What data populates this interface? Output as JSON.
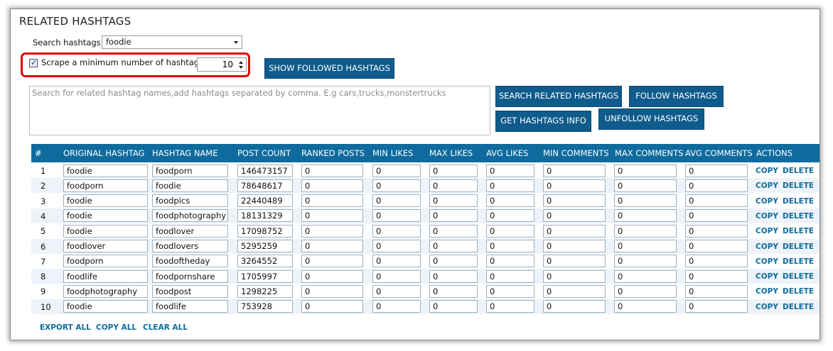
{
  "title": "RELATED HASHTAGS",
  "search": {
    "label": "Search hashtags",
    "value": "foodie"
  },
  "scrape": {
    "label": "Scrape a minimum number of hashtags",
    "checked": "✓",
    "value": "10"
  },
  "buttons": {
    "show_followed": "SHOW FOLLOWED HASHTAGS",
    "search_related": "SEARCH RELATED HASHTAGS",
    "follow": "FOLLOW HASHTAGS",
    "get_info": "GET HASHTAGS INFO",
    "unfollow": "UNFOLLOW HASHTAGS"
  },
  "textarea_placeholder": "Search for related hashtag names,add hashtags separated by comma. E.g cars,trucks,monstertrucks",
  "table": {
    "headers": [
      "#",
      "ORIGINAL HASHTAG",
      "HASHTAG NAME",
      "POST COUNT",
      "RANKED POSTS",
      "MIN LIKES",
      "MAX LIKES",
      "AVG LIKES",
      "MIN COMMENTS",
      "MAX COMMENTS",
      "AVG COMMENTS",
      "ACTIONS"
    ],
    "rows": [
      {
        "num": "1",
        "original": "foodie",
        "name": "foodporn",
        "post_count": "146473157",
        "ranked": "0",
        "min_likes": "0",
        "max_likes": "0",
        "avg_likes": "0",
        "min_comments": "0",
        "max_comments": "0",
        "avg_comments": "0"
      },
      {
        "num": "2",
        "original": "foodporn",
        "name": "foodie",
        "post_count": "78648617",
        "ranked": "0",
        "min_likes": "0",
        "max_likes": "0",
        "avg_likes": "0",
        "min_comments": "0",
        "max_comments": "0",
        "avg_comments": "0"
      },
      {
        "num": "3",
        "original": "foodie",
        "name": "foodpics",
        "post_count": "22440489",
        "ranked": "0",
        "min_likes": "0",
        "max_likes": "0",
        "avg_likes": "0",
        "min_comments": "0",
        "max_comments": "0",
        "avg_comments": "0"
      },
      {
        "num": "4",
        "original": "foodie",
        "name": "foodphotography",
        "post_count": "18131329",
        "ranked": "0",
        "min_likes": "0",
        "max_likes": "0",
        "avg_likes": "0",
        "min_comments": "0",
        "max_comments": "0",
        "avg_comments": "0"
      },
      {
        "num": "5",
        "original": "foodie",
        "name": "foodlover",
        "post_count": "17098752",
        "ranked": "0",
        "min_likes": "0",
        "max_likes": "0",
        "avg_likes": "0",
        "min_comments": "0",
        "max_comments": "0",
        "avg_comments": "0"
      },
      {
        "num": "6",
        "original": "foodlover",
        "name": "foodlovers",
        "post_count": "5295259",
        "ranked": "0",
        "min_likes": "0",
        "max_likes": "0",
        "avg_likes": "0",
        "min_comments": "0",
        "max_comments": "0",
        "avg_comments": "0"
      },
      {
        "num": "7",
        "original": "foodporn",
        "name": "foodoftheday",
        "post_count": "3264552",
        "ranked": "0",
        "min_likes": "0",
        "max_likes": "0",
        "avg_likes": "0",
        "min_comments": "0",
        "max_comments": "0",
        "avg_comments": "0"
      },
      {
        "num": "8",
        "original": "foodlife",
        "name": "foodpornshare",
        "post_count": "1705997",
        "ranked": "0",
        "min_likes": "0",
        "max_likes": "0",
        "avg_likes": "0",
        "min_comments": "0",
        "max_comments": "0",
        "avg_comments": "0"
      },
      {
        "num": "9",
        "original": "foodphotography",
        "name": "foodpost",
        "post_count": "1298225",
        "ranked": "0",
        "min_likes": "0",
        "max_likes": "0",
        "avg_likes": "0",
        "min_comments": "0",
        "max_comments": "0",
        "avg_comments": "0"
      },
      {
        "num": "10",
        "original": "foodie",
        "name": "foodlife",
        "post_count": "753928",
        "ranked": "0",
        "min_likes": "0",
        "max_likes": "0",
        "avg_likes": "0",
        "min_comments": "0",
        "max_comments": "0",
        "avg_comments": "0"
      }
    ],
    "actions": {
      "copy": "COPY",
      "delete": "DELETE"
    }
  },
  "footer": {
    "export_all": "EXPORT ALL",
    "copy_all": "COPY ALL",
    "clear_all": "CLEAR ALL"
  },
  "colors": {
    "accent": "#0f6b9e",
    "button": "#0f5c8c",
    "highlight": "#e00000",
    "row_alt": "#edf3f8"
  }
}
